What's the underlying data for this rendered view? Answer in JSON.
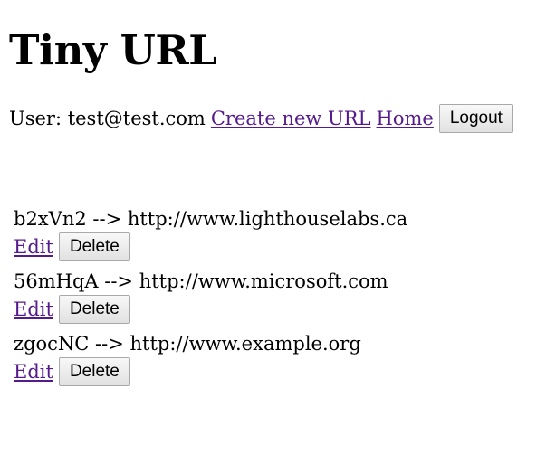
{
  "header": {
    "title": "Tiny URL"
  },
  "nav": {
    "user_text": "User: test@test.com",
    "create_link": "Create new URL",
    "home_link": "Home",
    "logout_button": "Logout"
  },
  "urls": [
    {
      "line": "b2xVn2 --> http://www.lighthouselabs.ca",
      "edit": "Edit",
      "delete": "Delete"
    },
    {
      "line": "56mHqA --> http://www.microsoft.com",
      "edit": "Edit",
      "delete": "Delete"
    },
    {
      "line": "zgocNC --> http://www.example.org",
      "edit": "Edit",
      "delete": "Delete"
    }
  ]
}
